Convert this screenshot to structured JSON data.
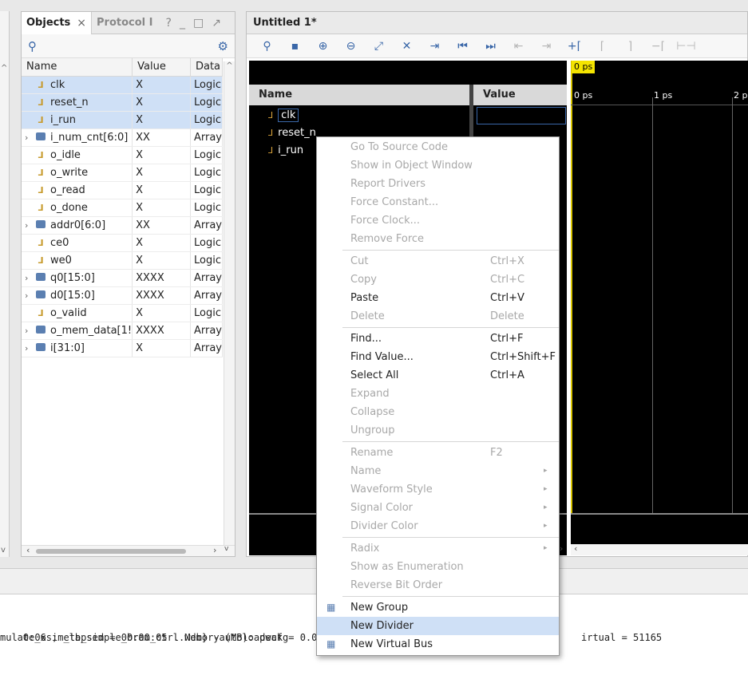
{
  "objects_panel": {
    "tab_objects": "Objects",
    "tab_protocol": "Protocol I",
    "columns": [
      "Name",
      "Value",
      "Data"
    ],
    "rows": [
      {
        "name": "clk",
        "value": "X",
        "data": "Logic",
        "kind": "logic",
        "selected": true
      },
      {
        "name": "reset_n",
        "value": "X",
        "data": "Logic",
        "kind": "logic",
        "selected": true
      },
      {
        "name": "i_run",
        "value": "X",
        "data": "Logic",
        "kind": "logic",
        "selected": true
      },
      {
        "name": "i_num_cnt[6:0]",
        "value": "XX",
        "data": "Array",
        "kind": "array",
        "selected": false
      },
      {
        "name": "o_idle",
        "value": "X",
        "data": "Logic",
        "kind": "logic",
        "selected": false
      },
      {
        "name": "o_write",
        "value": "X",
        "data": "Logic",
        "kind": "logic",
        "selected": false
      },
      {
        "name": "o_read",
        "value": "X",
        "data": "Logic",
        "kind": "logic",
        "selected": false
      },
      {
        "name": "o_done",
        "value": "X",
        "data": "Logic",
        "kind": "logic",
        "selected": false
      },
      {
        "name": "addr0[6:0]",
        "value": "XX",
        "data": "Array",
        "kind": "array",
        "selected": false
      },
      {
        "name": "ce0",
        "value": "X",
        "data": "Logic",
        "kind": "logic",
        "selected": false
      },
      {
        "name": "we0",
        "value": "X",
        "data": "Logic",
        "kind": "logic",
        "selected": false
      },
      {
        "name": "q0[15:0]",
        "value": "XXXX",
        "data": "Array",
        "kind": "array",
        "selected": false
      },
      {
        "name": "d0[15:0]",
        "value": "XXXX",
        "data": "Array",
        "kind": "array",
        "selected": false
      },
      {
        "name": "o_valid",
        "value": "X",
        "data": "Logic",
        "kind": "logic",
        "selected": false
      },
      {
        "name": "o_mem_data[1!",
        "value": "XXXX",
        "data": "Array",
        "kind": "array",
        "selected": false
      },
      {
        "name": "i[31:0]",
        "value": "X",
        "data": "Array",
        "kind": "array",
        "selected": false
      }
    ]
  },
  "wave_window": {
    "title": "Untitled 1*",
    "name_header": "Name",
    "value_header": "Value",
    "cursor_label": "0 ps",
    "ticks": [
      "0 ps",
      "1 ps",
      "2 p"
    ],
    "signals": [
      "clk",
      "reset_n",
      "i_run"
    ]
  },
  "context_menu": [
    {
      "label": "Go To Source Code",
      "shortcut": "",
      "enabled": false
    },
    {
      "label": "Show in Object Window",
      "shortcut": "",
      "enabled": false
    },
    {
      "label": "Report Drivers",
      "shortcut": "",
      "enabled": false
    },
    {
      "label": "Force Constant...",
      "shortcut": "",
      "enabled": false
    },
    {
      "label": "Force Clock...",
      "shortcut": "",
      "enabled": false
    },
    {
      "label": "Remove Force",
      "shortcut": "",
      "enabled": false
    },
    {
      "label": "Cut",
      "shortcut": "Ctrl+X",
      "enabled": false
    },
    {
      "label": "Copy",
      "shortcut": "Ctrl+C",
      "enabled": false
    },
    {
      "label": "Paste",
      "shortcut": "Ctrl+V",
      "enabled": true
    },
    {
      "label": "Delete",
      "shortcut": "Delete",
      "enabled": false
    },
    {
      "label": "Find...",
      "shortcut": "Ctrl+F",
      "enabled": true
    },
    {
      "label": "Find Value...",
      "shortcut": "Ctrl+Shift+F",
      "enabled": true
    },
    {
      "label": "Select All",
      "shortcut": "Ctrl+A",
      "enabled": true
    },
    {
      "label": "Expand",
      "shortcut": "",
      "enabled": false
    },
    {
      "label": "Collapse",
      "shortcut": "",
      "enabled": false
    },
    {
      "label": "Ungroup",
      "shortcut": "",
      "enabled": false
    },
    {
      "label": "Rename",
      "shortcut": "F2",
      "enabled": false
    },
    {
      "label": "Name",
      "shortcut": "",
      "enabled": false,
      "submenu": true
    },
    {
      "label": "Waveform Style",
      "shortcut": "",
      "enabled": false,
      "submenu": true
    },
    {
      "label": "Signal Color",
      "shortcut": "",
      "enabled": false,
      "submenu": true
    },
    {
      "label": "Divider Color",
      "shortcut": "",
      "enabled": false,
      "submenu": true
    },
    {
      "label": "Radix",
      "shortcut": "",
      "enabled": false,
      "submenu": true
    },
    {
      "label": "Show as Enumeration",
      "shortcut": "",
      "enabled": false
    },
    {
      "label": "Reverse Bit Order",
      "shortcut": "",
      "enabled": false
    },
    {
      "label": "New Group",
      "shortcut": "",
      "enabled": true
    },
    {
      "label": "New Divider",
      "shortcut": "",
      "enabled": true,
      "highlighted": true
    },
    {
      "label": "New Virtual Bus",
      "shortcut": "",
      "enabled": true
    }
  ],
  "console": {
    "line1_left": "0:06 ; elapsed = 00:00:05 . Memory (MB): peak = 0.000 ; ",
    "line1_right": "irtual = 51165",
    "line2": "mulate_xsim_tb_simple_bram_ctrl.wdb} -autoloadwcfg"
  }
}
